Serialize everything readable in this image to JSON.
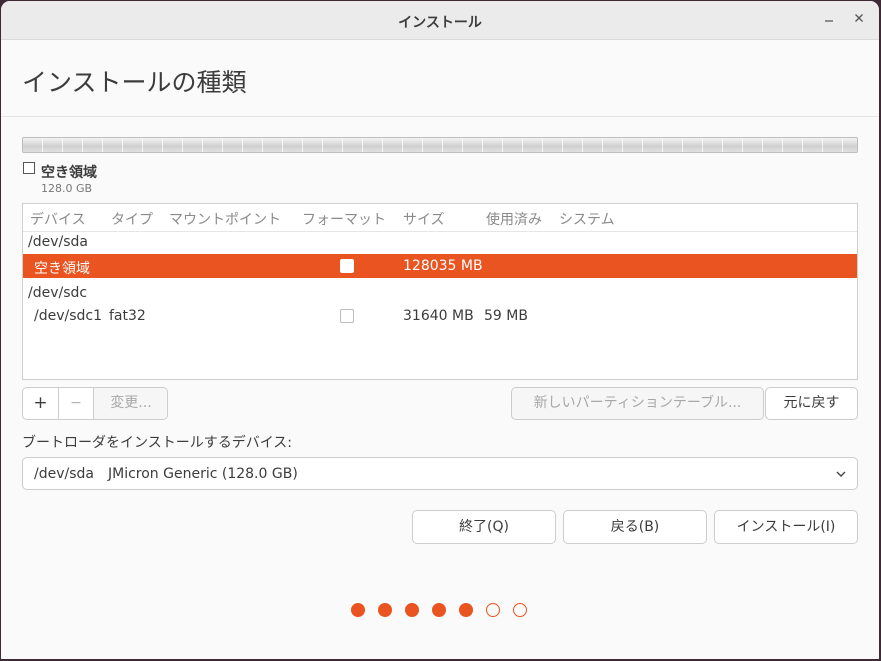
{
  "window": {
    "title": "インストール",
    "minimize_icon": "minimize-icon",
    "close_icon": "close-icon"
  },
  "page": {
    "heading": "インストールの種類"
  },
  "partition_bar": {
    "legend_name": "空き領域",
    "legend_size": "128.0 GB"
  },
  "table": {
    "headers": [
      "デバイス",
      "タイプ",
      "マウントポイント",
      "フォーマット",
      "サイズ",
      "使用済み",
      "システム"
    ],
    "rows": [
      {
        "kind": "disk",
        "device": "/dev/sda"
      },
      {
        "kind": "partition",
        "device": "空き領域",
        "type": "",
        "mount": "",
        "format": false,
        "size": "128035 MB",
        "used": "",
        "system": "",
        "selected": true
      },
      {
        "kind": "disk",
        "device": "/dev/sdc"
      },
      {
        "kind": "partition",
        "device": "/dev/sdc1",
        "type": "fat32",
        "mount": "",
        "format": false,
        "size": "31640 MB",
        "used": "59 MB",
        "system": "",
        "selected": false
      }
    ]
  },
  "toolbar": {
    "add_label": "+",
    "remove_label": "−",
    "change_label": "変更...",
    "new_table_label": "新しいパーティションテーブル...",
    "revert_label": "元に戻す"
  },
  "bootloader": {
    "label": "ブートローダをインストールするデバイス:",
    "selected_device": "/dev/sda",
    "selected_model": "JMicron Generic (128.0 GB)"
  },
  "actions": {
    "quit_label": "終了(Q)",
    "back_label": "戻る(B)",
    "install_label": "インストール(I)"
  },
  "progress": {
    "total_steps": 7,
    "completed_steps": 5
  },
  "colors": {
    "accent": "#e95420"
  }
}
